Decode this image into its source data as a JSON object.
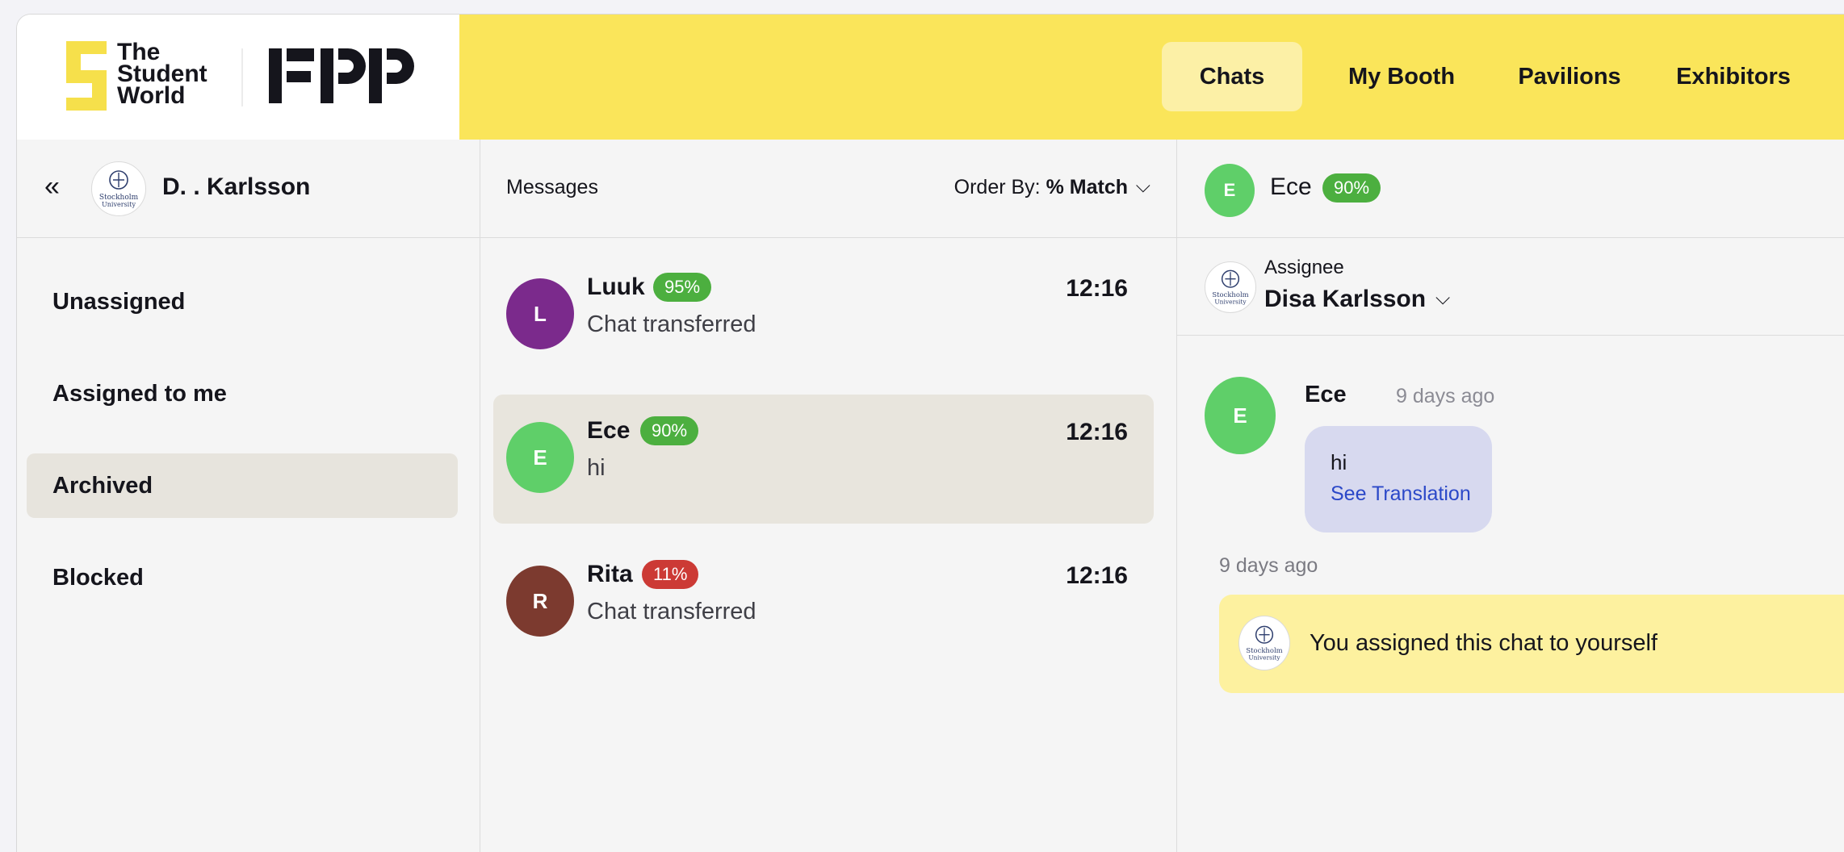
{
  "brand": {
    "logo_line1": "The",
    "logo_line2": "Student",
    "logo_line3": "World",
    "partner_logo": "FPP",
    "colors": {
      "header_yellow": "#fae55a",
      "active_nav": "#fcf0a6"
    }
  },
  "nav": {
    "items": [
      {
        "label": "Chats",
        "active": true
      },
      {
        "label": "My Booth",
        "active": false
      },
      {
        "label": "Pavilions",
        "active": false
      },
      {
        "label": "Exhibitors",
        "active": false
      }
    ]
  },
  "sidebar": {
    "collapse_icon": "double-chevron-left-icon",
    "user_name": "D. . Karlsson",
    "university_logo_text": "Stockholm University",
    "items": [
      {
        "label": "Unassigned",
        "active": false
      },
      {
        "label": "Assigned to me",
        "active": false
      },
      {
        "label": "Archived",
        "active": true
      },
      {
        "label": "Blocked",
        "active": false
      }
    ]
  },
  "messages": {
    "title": "Messages",
    "order_by_label": "Order By:",
    "order_by_value": "% Match",
    "conversations": [
      {
        "initial": "L",
        "name": "Luuk",
        "match": "95%",
        "time": "12:16",
        "preview": "Chat transferred",
        "avatar_color": "#7b2a8c",
        "badge_color": "#4caf3f",
        "active": false
      },
      {
        "initial": "E",
        "name": "Ece",
        "match": "90%",
        "time": "12:16",
        "preview": "hi",
        "avatar_color": "#5fcf69",
        "badge_color": "#4caf3f",
        "active": true
      },
      {
        "initial": "R",
        "name": "Rita",
        "match": "11%",
        "time": "12:16",
        "preview": "Chat transferred",
        "avatar_color": "#7c3a2f",
        "badge_color": "#cc3a35",
        "active": false
      }
    ]
  },
  "chat": {
    "header": {
      "initial": "E",
      "name": "Ece",
      "match": "90%"
    },
    "assignee_label": "Assignee",
    "assignee_name": "Disa Karlsson",
    "message": {
      "initial": "E",
      "author": "Ece",
      "time": "9 days ago",
      "text": "hi",
      "translate": "See Translation"
    },
    "system_time": "9 days ago",
    "system_message": "You assigned this chat to yourself"
  }
}
